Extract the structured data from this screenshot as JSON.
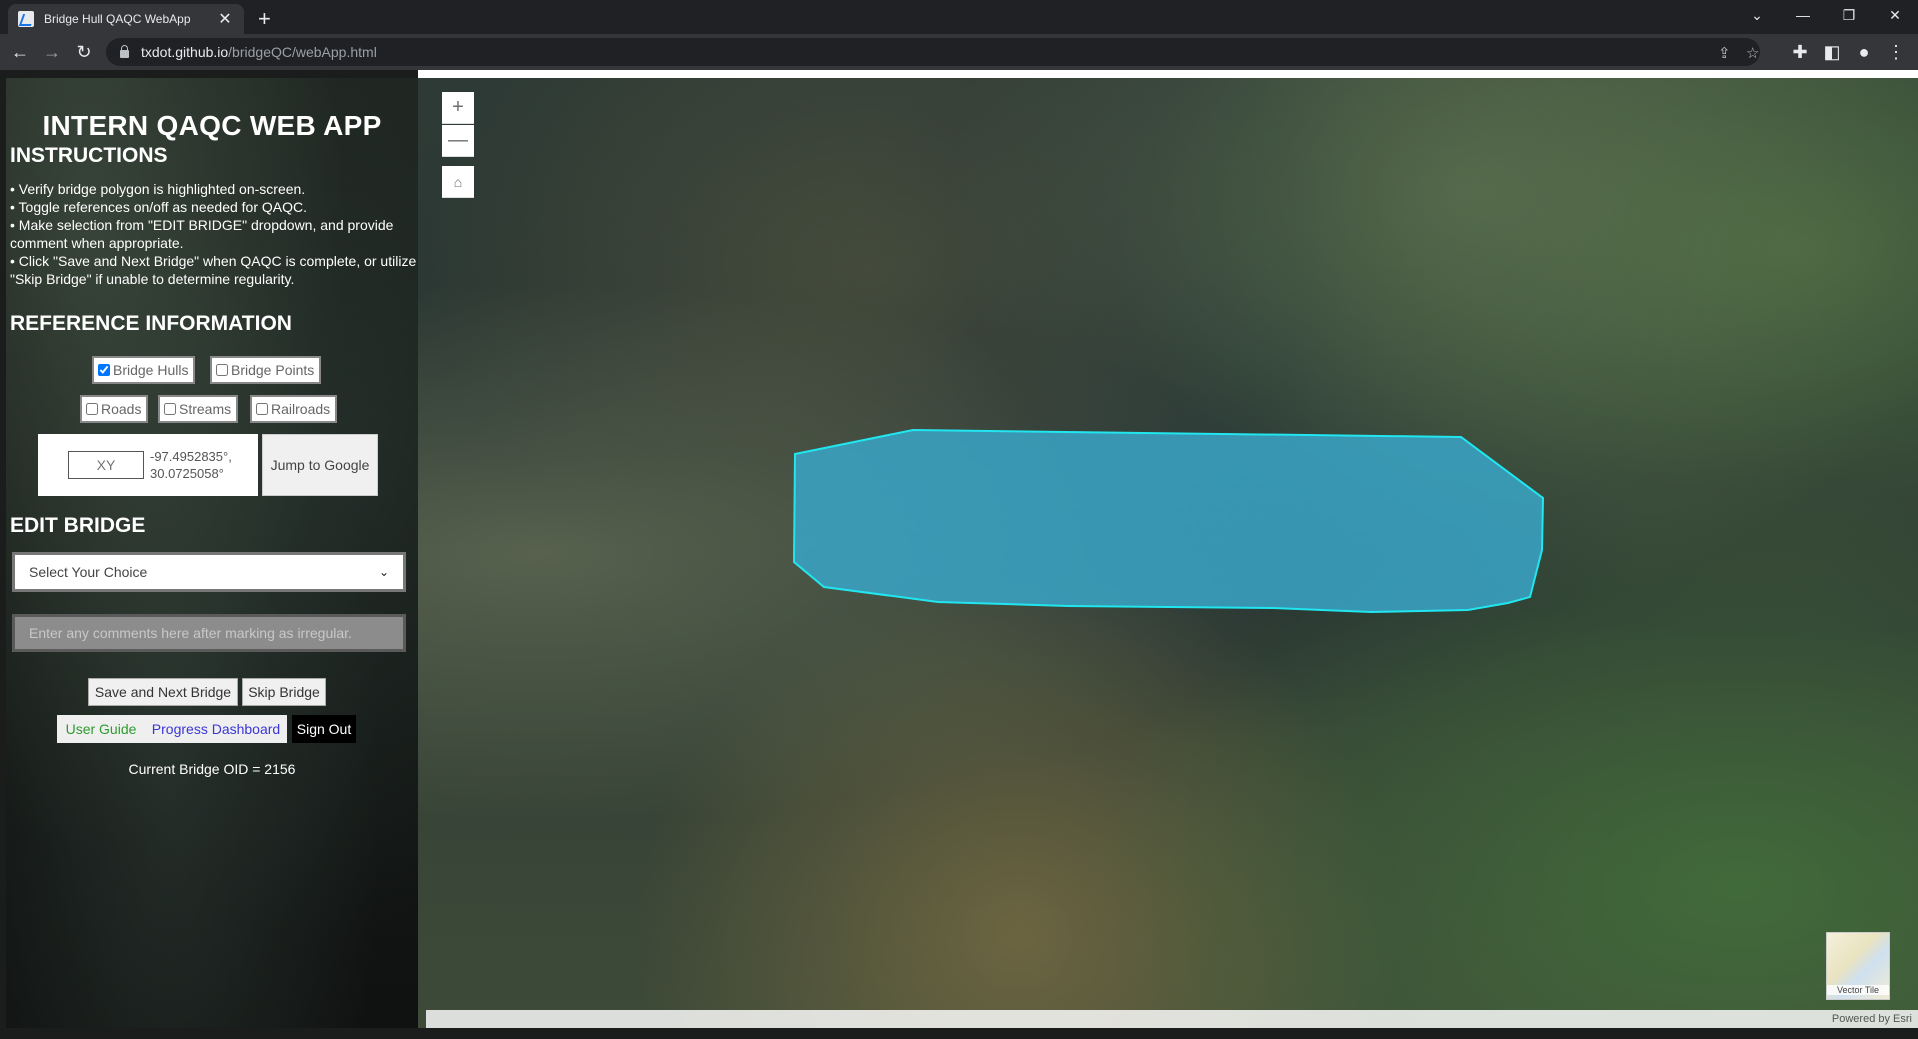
{
  "browser": {
    "tab_title": "Bridge Hull QAQC WebApp",
    "url_host": "txdot.github.io",
    "url_path": "/bridgeQC/webApp.html"
  },
  "panel": {
    "title": "INTERN QAQC WEB APP",
    "instructions_heading": "INSTRUCTIONS",
    "instructions": [
      "•    Verify bridge polygon is highlighted on-screen.",
      "•    Toggle references on/off as needed for QAQC.",
      "•    Make selection from \"EDIT BRIDGE\" dropdown, and provide comment when appropriate.",
      "•    Click \"Save and Next Bridge\" when QAQC is complete, or utilize \"Skip Bridge\" if unable to determine regularity."
    ],
    "reference_heading": "REFERENCE INFORMATION",
    "layers": {
      "bridge_hulls": "Bridge Hulls",
      "bridge_points": "Bridge Points",
      "roads": "Roads",
      "streams": "Streams",
      "railroads": "Railroads"
    },
    "xy_placeholder": "XY",
    "coords_line1": "-97.4952835°,",
    "coords_line2": "30.0725058°",
    "jump_label": "Jump to Google",
    "edit_heading": "EDIT BRIDGE",
    "select_value": "Select Your Choice",
    "comment_placeholder": "Enter any comments here after marking as irregular.",
    "save_label": "Save and Next Bridge",
    "skip_label": "Skip Bridge",
    "guide_label": "User Guide",
    "dashboard_label": "Progress Dashboard",
    "signout_label": "Sign Out",
    "oid_text": "Current Bridge OID = 2156"
  },
  "map": {
    "zoom_in": "+",
    "zoom_out": "—",
    "home_icon": "home-icon",
    "basemap_label": "Vector Tile",
    "attribution": "Powered by Esri",
    "polygon_fill": "#3aa6c8",
    "polygon_stroke": "#21e6f0"
  }
}
